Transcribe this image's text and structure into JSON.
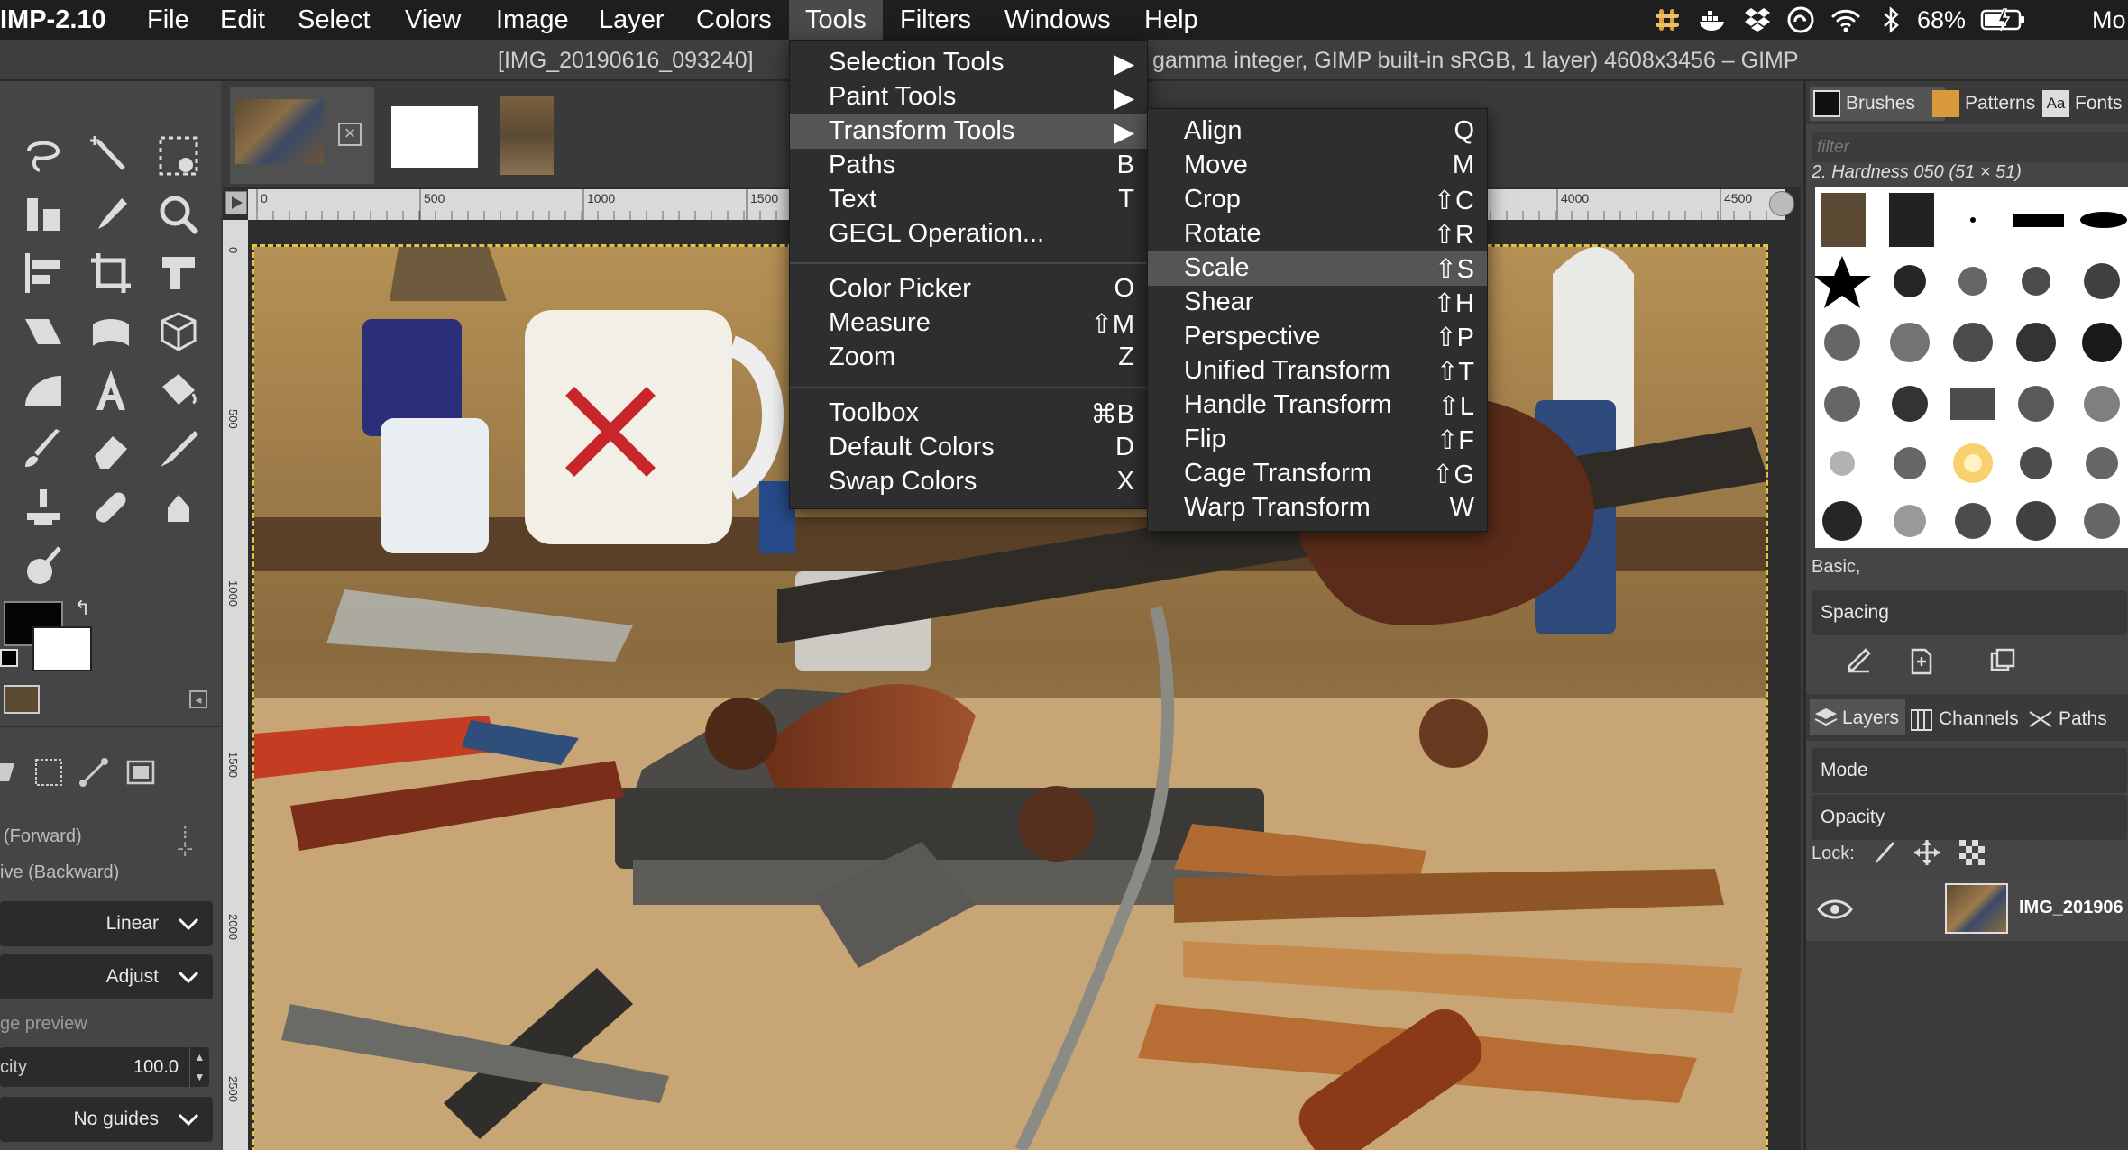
{
  "app": {
    "name": "IMP-2.10"
  },
  "menubar": {
    "items": [
      {
        "label": "File"
      },
      {
        "label": "Edit"
      },
      {
        "label": "Select"
      },
      {
        "label": "View"
      },
      {
        "label": "Image"
      },
      {
        "label": "Layer"
      },
      {
        "label": "Colors"
      },
      {
        "label": "Tools"
      },
      {
        "label": "Filters"
      },
      {
        "label": "Windows"
      },
      {
        "label": "Help"
      }
    ],
    "active": "Tools"
  },
  "status_bar": {
    "battery": "68%",
    "clock_partial": "Mo",
    "icons": [
      "slack-icon",
      "docker-icon",
      "dropbox-icon",
      "creative-cloud-icon",
      "wifi-icon",
      "bluetooth-icon",
      "battery-icon"
    ]
  },
  "title": {
    "left": "[IMG_20190616_093240]",
    "right": "gamma integer, GIMP built-in sRGB, 1 layer) 4608x3456 – GIMP"
  },
  "tools_menu": {
    "groups": [
      [
        {
          "label": "Selection Tools",
          "shortcut": "▶"
        },
        {
          "label": "Paint Tools",
          "shortcut": "▶"
        },
        {
          "label": "Transform Tools",
          "shortcut": "▶",
          "highlighted": true
        },
        {
          "label": "Paths",
          "shortcut": "B"
        },
        {
          "label": "Text",
          "shortcut": "T"
        },
        {
          "label": "GEGL Operation...",
          "shortcut": ""
        }
      ],
      [
        {
          "label": "Color Picker",
          "shortcut": "O"
        },
        {
          "label": "Measure",
          "shortcut": "⇧M"
        },
        {
          "label": "Zoom",
          "shortcut": "Z"
        }
      ],
      [
        {
          "label": "Toolbox",
          "shortcut": "⌘B"
        },
        {
          "label": "Default Colors",
          "shortcut": "D"
        },
        {
          "label": "Swap Colors",
          "shortcut": "X"
        }
      ]
    ]
  },
  "transform_menu": {
    "items": [
      {
        "label": "Align",
        "shortcut": "Q"
      },
      {
        "label": "Move",
        "shortcut": "M"
      },
      {
        "label": "Crop",
        "shortcut": "⇧C"
      },
      {
        "label": "Rotate",
        "shortcut": "⇧R"
      },
      {
        "label": "Scale",
        "shortcut": "⇧S",
        "highlighted": true
      },
      {
        "label": "Shear",
        "shortcut": "⇧H"
      },
      {
        "label": "Perspective",
        "shortcut": "⇧P"
      },
      {
        "label": "Unified Transform",
        "shortcut": "⇧T"
      },
      {
        "label": "Handle Transform",
        "shortcut": "⇧L"
      },
      {
        "label": "Flip",
        "shortcut": "⇧F"
      },
      {
        "label": "Cage Transform",
        "shortcut": "⇧G"
      },
      {
        "label": "Warp Transform",
        "shortcut": "W"
      }
    ]
  },
  "ruler": {
    "h_labels": [
      "0",
      "500",
      "1000",
      "1500",
      "4000",
      "4500"
    ],
    "v_labels": [
      "0",
      "500",
      "1000",
      "1500",
      "2000",
      "2500"
    ]
  },
  "tool_options": {
    "forward": "(Forward)",
    "backward": "ive (Backward)",
    "interpolation": "Linear",
    "clipping": "Adjust",
    "preview": "ge preview",
    "opacity_label": "city",
    "opacity_value": "100.0",
    "guides": "No guides"
  },
  "right_panel": {
    "tabs_top": [
      "Brushes",
      "Patterns",
      "Fonts"
    ],
    "font_tab_icon": "Aa",
    "filter_placeholder": "filter",
    "brush_name": "2. Hardness 050 (51 × 51)",
    "preset": "Basic,",
    "spacing_label": "Spacing",
    "tabs_bottom": [
      "Layers",
      "Channels",
      "Paths"
    ],
    "mode_label": "Mode",
    "opacity_label": "Opacity",
    "lock_label": "Lock:",
    "layer_name": "IMG_201906"
  },
  "colors": {
    "menu_bg": "#2e2e2e",
    "highlight": "#555555",
    "selection_marching": "#e2c441"
  }
}
